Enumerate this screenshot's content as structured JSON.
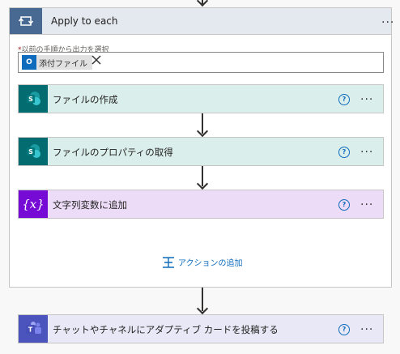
{
  "loop": {
    "title": "Apply to each",
    "more_label": "...",
    "field_label": "以前の手順から出力を選択",
    "token": {
      "label": "添付ファイル",
      "icon": "outlook-icon"
    },
    "actions": [
      {
        "title": "ファイルの作成",
        "icon": "sharepoint-icon",
        "color": "#daeeeb"
      },
      {
        "title": "ファイルのプロパティの取得",
        "icon": "sharepoint-icon",
        "color": "#daeeeb"
      },
      {
        "title": "文字列変数に追加",
        "icon": "variable-icon",
        "color": "#ecdcf7"
      }
    ],
    "add_action_label": "アクションの追加"
  },
  "after": {
    "title": "チャットやチャネルにアダプティブ カードを投稿する",
    "icon": "teams-icon",
    "color": "#e8e8f6"
  },
  "help_label": "?",
  "colors": {
    "loop_header": "#e4e8ef",
    "loop_icon": "#486991",
    "sharepoint": "#036c70",
    "variable": "#770bd6",
    "teams": "#4b53bc",
    "link": "#0f6cbd"
  }
}
